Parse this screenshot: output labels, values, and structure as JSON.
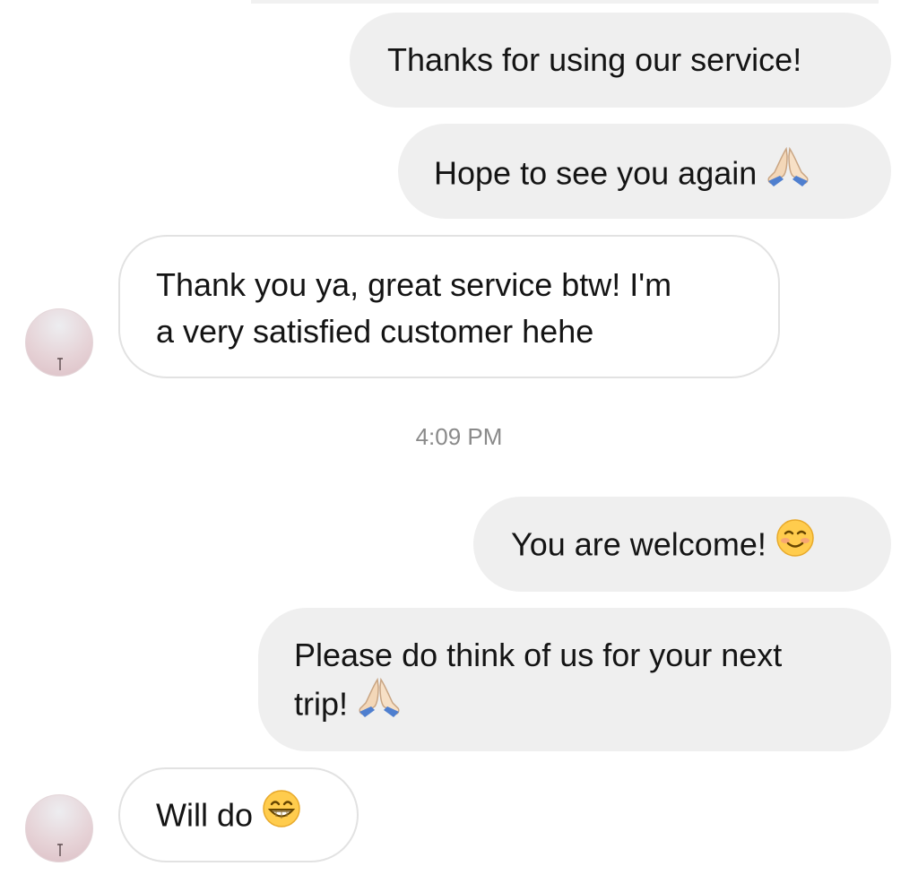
{
  "messages": {
    "m1": {
      "sender": "business",
      "text": "Thanks for using our service!"
    },
    "m2": {
      "sender": "business",
      "text": "Hope to see you again",
      "emoji": "folded-hands"
    },
    "m3": {
      "sender": "customer",
      "lines": [
        "Thank you ya, great service btw! I'm",
        "a very satisfied customer hehe"
      ]
    },
    "m4": {
      "sender": "business",
      "text": "You are welcome!",
      "emoji": "smiling-face"
    },
    "m5": {
      "sender": "business",
      "lines": [
        "Please do think of us for your next",
        "trip!"
      ],
      "emoji": "folded-hands"
    },
    "m6": {
      "sender": "customer",
      "text": "Will do",
      "emoji": "grinning-face"
    }
  },
  "timestamp": "4:09 PM",
  "colors": {
    "outgoing_bubble": "#efefef",
    "incoming_border": "#e2e2e2",
    "timestamp_text": "#8a8a8a"
  }
}
